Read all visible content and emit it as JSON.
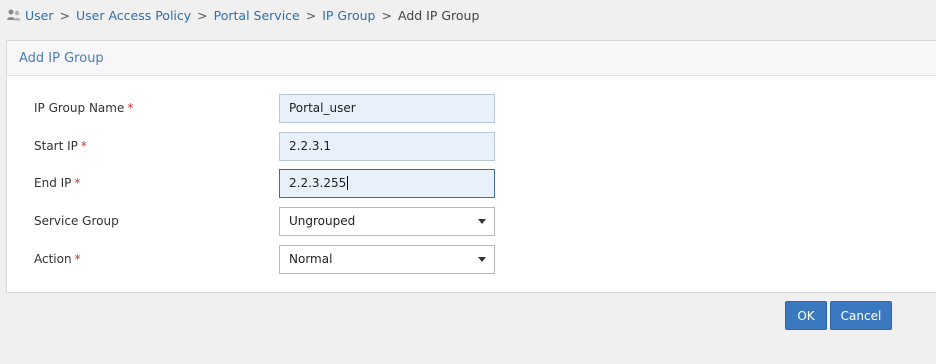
{
  "breadcrumb": {
    "items": [
      "User",
      "User Access Policy",
      "Portal Service",
      "IP Group"
    ],
    "separator": ">",
    "current": "Add IP Group"
  },
  "panel": {
    "title": "Add IP Group"
  },
  "form": {
    "required_mark": "*",
    "ip_group_name": {
      "label": "IP Group Name",
      "value": "Portal_user"
    },
    "start_ip": {
      "label": "Start IP",
      "value": "2.2.3.1"
    },
    "end_ip": {
      "label": "End IP",
      "value": "2.2.3.255"
    },
    "service_group": {
      "label": "Service Group",
      "value": "Ungrouped"
    },
    "action": {
      "label": "Action",
      "value": "Normal"
    }
  },
  "buttons": {
    "ok": "OK",
    "cancel": "Cancel"
  },
  "colors": {
    "accent": "#3a79c0",
    "link": "#2f6fa8",
    "required": "#d23030",
    "input_bg": "#e8f0fa"
  }
}
